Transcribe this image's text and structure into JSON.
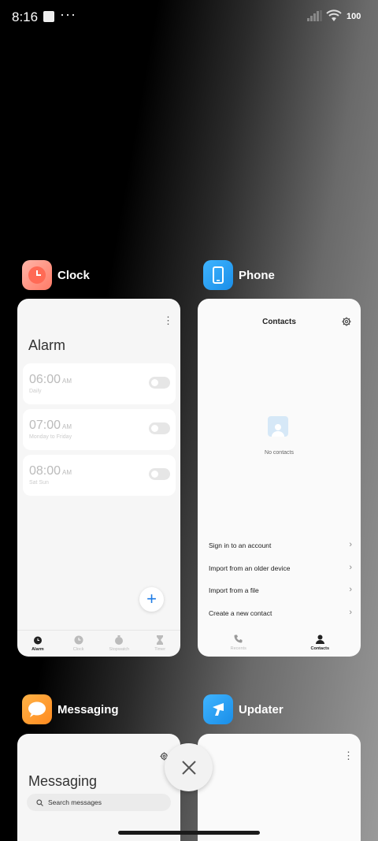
{
  "status_bar": {
    "time": "8:16",
    "more": "···",
    "battery": "100"
  },
  "cards": {
    "clock": {
      "app_name": "Clock",
      "screen_title": "Alarm",
      "alarms": [
        {
          "time": "06:00",
          "ampm": "AM",
          "repeat": "Daily",
          "enabled": false
        },
        {
          "time": "07:00",
          "ampm": "AM",
          "repeat": "Monday to Friday",
          "enabled": false
        },
        {
          "time": "08:00",
          "ampm": "AM",
          "repeat": "Sat Sun",
          "enabled": false
        }
      ],
      "add_label": "+",
      "nav": [
        "Alarm",
        "Clock",
        "Stopwatch",
        "Timer"
      ],
      "nav_active": "Alarm"
    },
    "phone": {
      "app_name": "Phone",
      "screen_title": "Contacts",
      "empty_text": "No contacts",
      "actions": [
        "Sign in to an account",
        "Import from an older device",
        "Import from a file",
        "Create a new contact"
      ],
      "nav": [
        "Recents",
        "Contacts"
      ],
      "nav_active": "Contacts"
    },
    "messaging": {
      "app_name": "Messaging",
      "screen_title": "Messaging",
      "search_placeholder": "Search messages"
    },
    "updater": {
      "app_name": "Updater"
    }
  },
  "colors": {
    "accent": "#1e7be5",
    "clock_icon": "#ff6f5c",
    "phone_icon": "#1b9bf0",
    "messaging_icon": "#ff9a2e",
    "updater_icon": "#1b9bf0"
  }
}
